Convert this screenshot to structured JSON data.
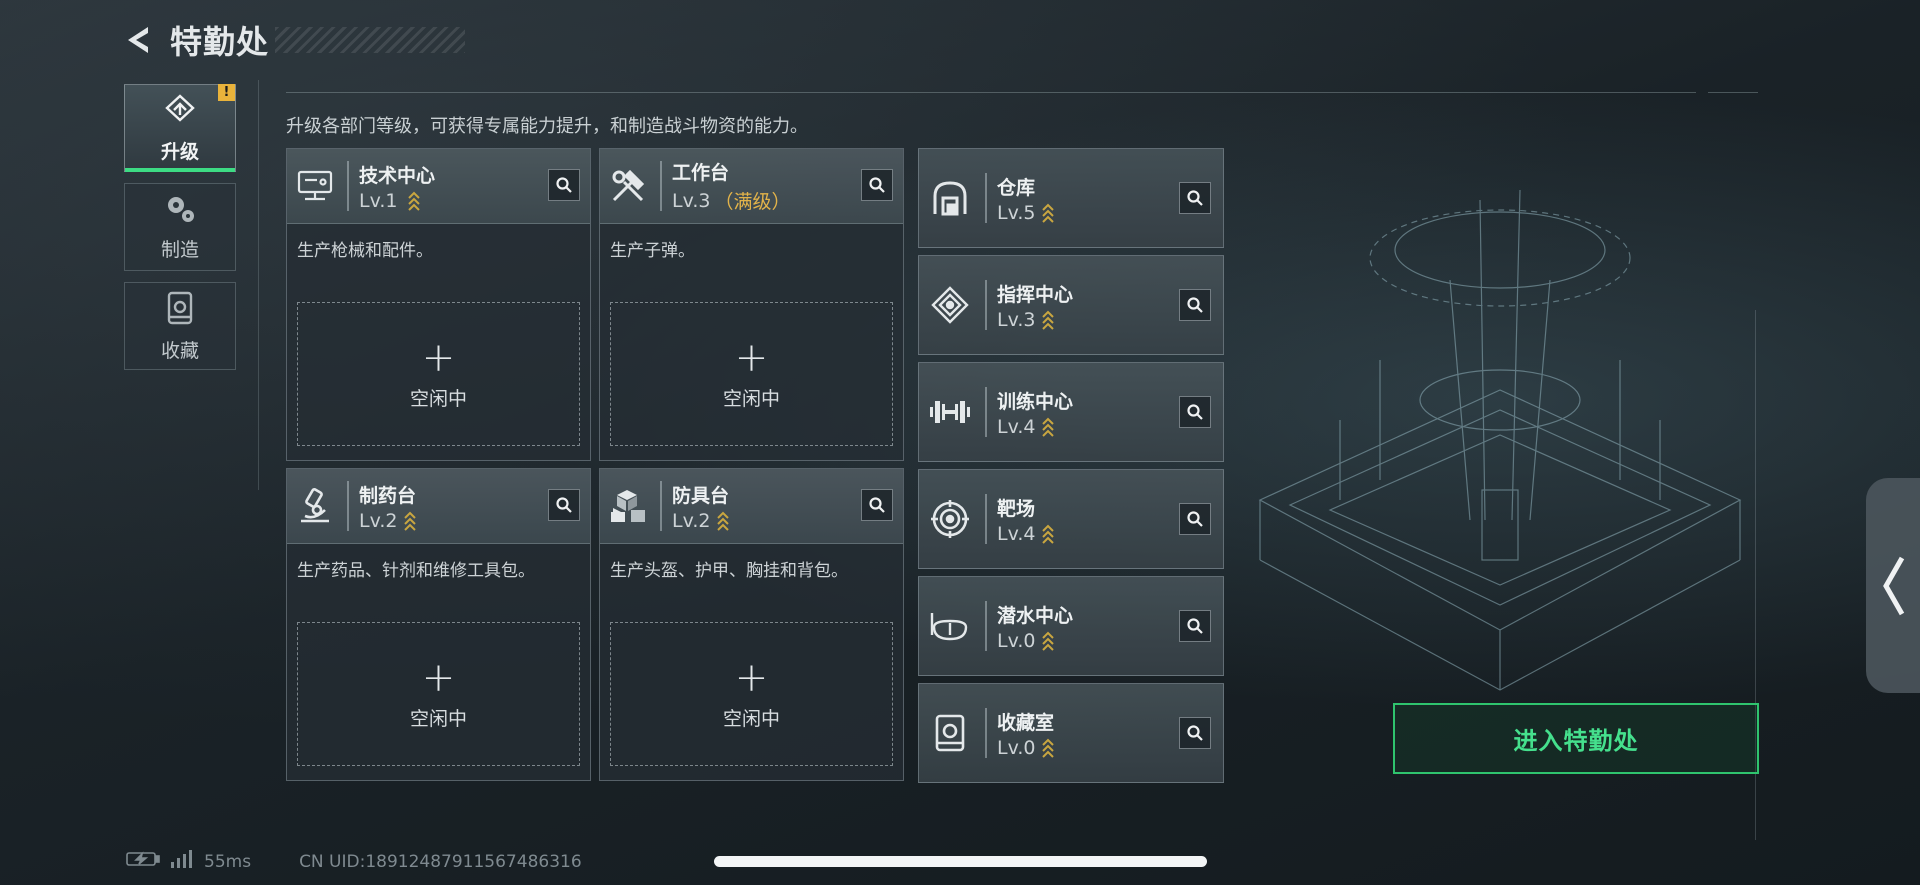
{
  "header": {
    "title": "特勤处"
  },
  "nav": [
    {
      "label": "升级",
      "icon": "upgrade-icon",
      "active": true,
      "badge": "!"
    },
    {
      "label": "制造",
      "icon": "gears-icon",
      "active": false
    },
    {
      "label": "收藏",
      "icon": "collection-icon",
      "active": false
    }
  ],
  "description": "升级各部门等级，可获得专属能力提升，和制造战斗物资的能力。",
  "workshops": [
    {
      "name": "技术中心",
      "level": "Lv.1",
      "maxed": "",
      "desc": "生产枪械和配件。",
      "slot_plus": "+",
      "slot_label": "空闲中",
      "icon": "monitor-icon"
    },
    {
      "name": "工作台",
      "level": "Lv.3",
      "maxed": "（满级）",
      "desc": "生产子弹。",
      "slot_plus": "+",
      "slot_label": "空闲中",
      "icon": "tools-icon"
    },
    {
      "name": "制药台",
      "level": "Lv.2",
      "maxed": "",
      "desc": "生产药品、针剂和维修工具包。",
      "slot_plus": "+",
      "slot_label": "空闲中",
      "icon": "microscope-icon"
    },
    {
      "name": "防具台",
      "level": "Lv.2",
      "maxed": "",
      "desc": "生产头盔、护甲、胸挂和背包。",
      "slot_plus": "+",
      "slot_label": "空闲中",
      "icon": "cubes-icon"
    }
  ],
  "facilities": [
    {
      "name": "仓库",
      "level": "Lv.5",
      "icon": "warehouse-icon"
    },
    {
      "name": "指挥中心",
      "level": "Lv.3",
      "icon": "command-icon"
    },
    {
      "name": "训练中心",
      "level": "Lv.4",
      "icon": "dumbbell-icon"
    },
    {
      "name": "靶场",
      "level": "Lv.4",
      "icon": "target-icon"
    },
    {
      "name": "潜水中心",
      "level": "Lv.0",
      "icon": "diving-mask-icon"
    },
    {
      "name": "收藏室",
      "level": "Lv.0",
      "icon": "collection-icon"
    }
  ],
  "enter_button": "进入特勤处",
  "status": {
    "ping": "55ms",
    "uid": "CN UID:18912487911567486316"
  },
  "colors": {
    "accent_green": "#3ddc84",
    "level_gold": "#e2b34a",
    "badge_yellow": "#e9b33b"
  }
}
